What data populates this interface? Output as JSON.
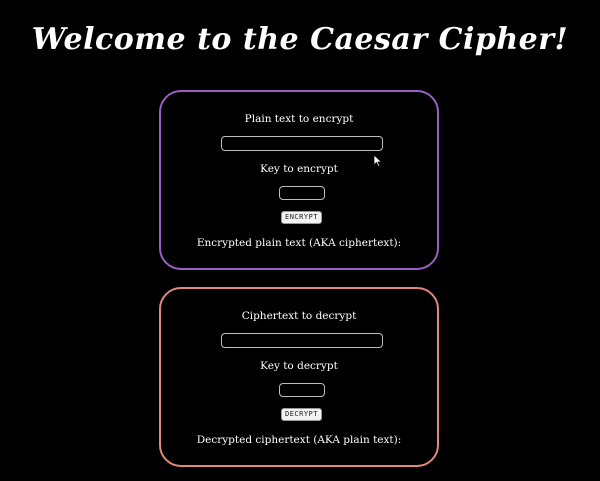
{
  "page": {
    "title": "Welcome to the Caesar Cipher!"
  },
  "encrypt": {
    "plain_label": "Plain text to encrypt",
    "plain_value": "",
    "key_label": "Key to encrypt",
    "key_value": "",
    "button_label": "ENCRYPT",
    "result_label": "Encrypted plain text (AKA ciphertext):"
  },
  "decrypt": {
    "cipher_label": "Ciphertext to decrypt",
    "cipher_value": "",
    "key_label": "Key to decrypt",
    "key_value": "",
    "button_label": "DECRYPT",
    "result_label": "Decrypted ciphertext (AKA plain text):"
  },
  "colors": {
    "background": "#000000",
    "encrypt_border": "#9b5fc0",
    "decrypt_border": "#e0897a"
  },
  "icons": {
    "cursor": "mouse-pointer-icon"
  }
}
